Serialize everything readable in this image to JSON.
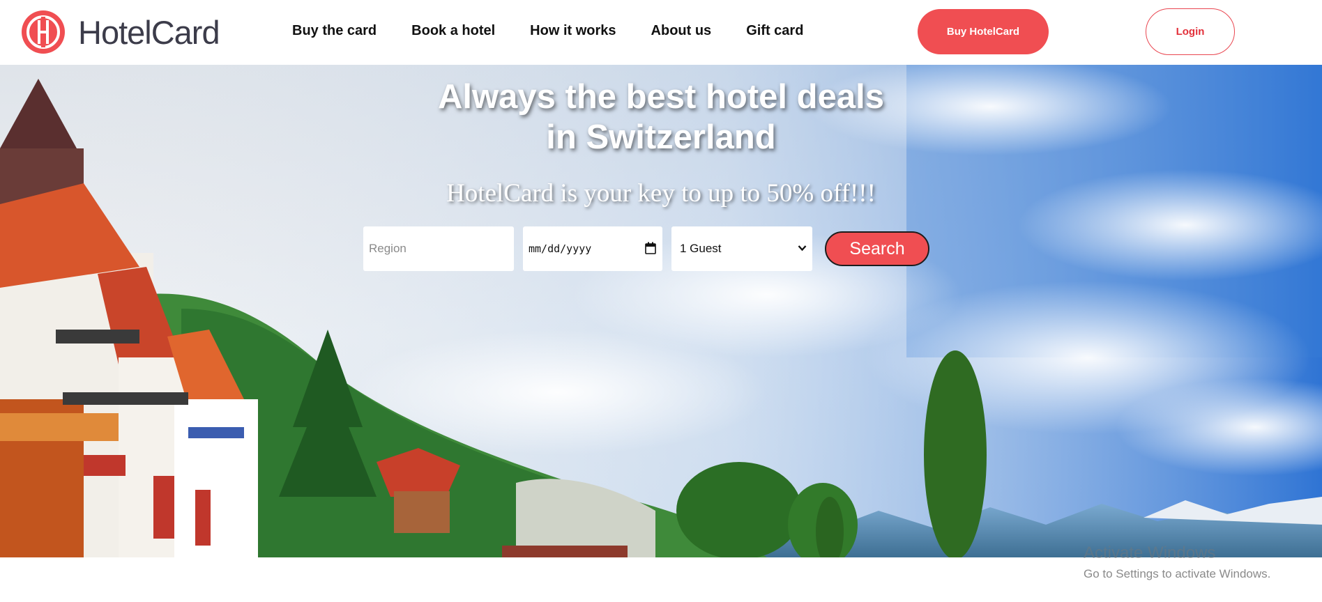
{
  "header": {
    "logo_text": "HotelCard",
    "nav": [
      "Buy the card",
      "Book a hotel",
      "How it works",
      "About us",
      "Gift card"
    ],
    "buy_button": "Buy HotelCard",
    "login_button": "Login"
  },
  "hero": {
    "title_line1": "Always the best hotel deals",
    "title_line2": "in Switzerland",
    "subtitle": "HotelCard is your key to up to 50% off!!!",
    "search": {
      "region_placeholder": "Region",
      "date_value": "mm/dd/yyyy",
      "guests_value": "1 Guest",
      "search_button": "Search"
    }
  },
  "watermark": {
    "title": "Activate Windows",
    "subtitle": "Go to Settings to activate Windows."
  },
  "colors": {
    "brand_red": "#f04e52",
    "sky_blue": "#3f7fd6"
  },
  "icons": [
    "hotelcard-logo-icon",
    "calendar-icon",
    "chevron-down-icon"
  ]
}
